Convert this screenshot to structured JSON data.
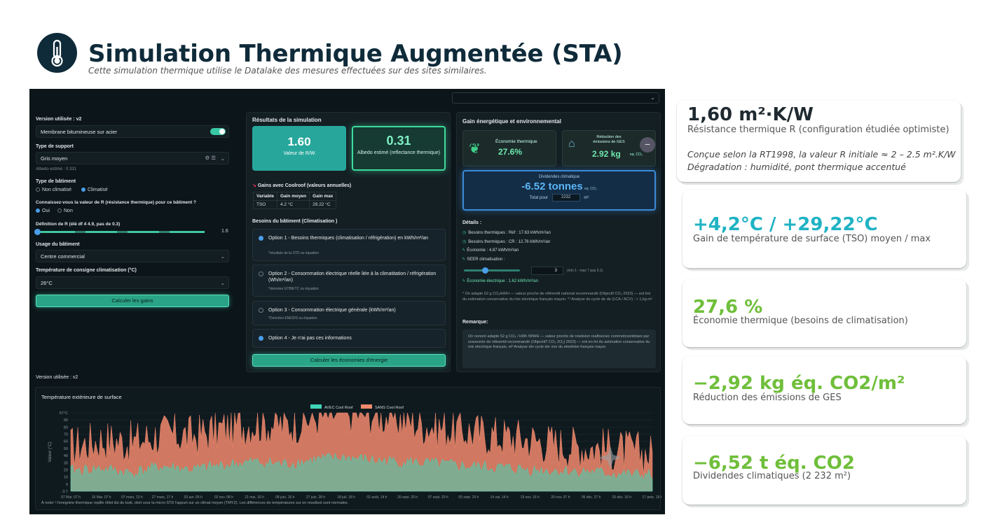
{
  "header": {
    "title": "Simulation Thermique Augmentée (STA)",
    "subtitle": "Cette simulation thermique utilise le Datalake des mesures effectuées sur des sites similaires.",
    "logo_icon": "thermometer-icon"
  },
  "app": {
    "left": {
      "version": "Version utilisée : v2",
      "membrane": "Membrane bitumineuse sur acier",
      "support_label": "Type de support",
      "support_value": "Gris moyen",
      "albedo_note": "Albedo estimé : 0.331",
      "batiment_label": "Type de bâtiment",
      "batiment_opt1": "Non climatisé",
      "batiment_opt2": "Climatisé",
      "r_question": "Connaissez-vous la valeur de R (résistance thermique) pour ce bâtiment ?",
      "r_yes": "Oui",
      "r_no": "Non",
      "r_def": "Définition de R (élé df 4 4.9, pas de 0.3)",
      "r_value": "1.6",
      "usage_label": "Usage du bâtiment",
      "usage_value": "Centre commercial",
      "temp_label": "Température de consigne climatisation (°C)",
      "temp_value": "26°C",
      "calc_button": "Calculer les gains"
    },
    "mid": {
      "title": "Résultats de la simulation",
      "r_value": "1.60",
      "r_caption": "Valeur de R/W",
      "albedo_value": "0.31",
      "albedo_caption": "Albedo estimé (reflectance thermique)",
      "gains_title": "Gains avec Coolroof (valeurs annuelles)",
      "table_headers": [
        "Variable",
        "Gain moyen",
        "Gain max"
      ],
      "table_row": [
        "TSO",
        "4.2 °C",
        "29.22 °C"
      ],
      "besoins_title": "Besoins du bâtiment (Climatisation )",
      "options": [
        {
          "label": "Option 1 - Besoins thermiques (climatisation / réfrigération) en kWh/m²/an",
          "note": "*résultats de la STD ou équation"
        },
        {
          "label": "Option 2 - Consommation électrique réelle liée à la climatitation / réfrigération (Wh/m²/an)",
          "note": "*données GTB/ETC ou équation"
        },
        {
          "label": "Option 3 - Consommation électrique générale (kWh/m²/an)",
          "note": "*Données ENEDIS ou équation"
        },
        {
          "label": "Option 4 - Je n'ai pas ces informations",
          "note": ""
        }
      ],
      "calc_button": "Calculer les économies d'énergie"
    },
    "right": {
      "title": "Gain énergétique et environnemental",
      "eco_label": "Économie thermique",
      "eco_value": "27.6%",
      "ges_label": "Réduction des émissions de GES",
      "ges_value": "2.92 kg",
      "ges_unit": "eq. CO₂",
      "div_label": "Dividendes climatique",
      "div_value": "-6.52 tonnes",
      "div_unit": "eq. CO₂",
      "total_label": "Total pour",
      "total_value": "2232",
      "total_unit": "m²",
      "details_title": "Détails :",
      "d1": "Besoins thermiques : Réf : 17.63 kWh/m²/an",
      "d2": "Besoins thermiques : CR : 12.76 kWh/m²/an",
      "d3": "Économie : 4.87 kWh/m²/an",
      "d4": "SEER climatisation :",
      "seer_value": "3",
      "seer_range": "(min 1 - max 7 pas 0.1)",
      "d5": "Économie électrique : 1.62 kWh/m²/an",
      "note": "* On adapte 52 g CO₂/kWH — valeur proche de référentil national recommandé (Objectif CO₂ 2023) — ent lint du estimation conservative du mix electrique français mayon. *¹ Analyse du cycle de de (LCA / ACV) : < 1,kg m²",
      "remark_title": "Remarque:",
      "remark": "On nonoré adapte 52 g CO₂ / kWh /WWH — valeur proche de nnelision reafloeciec commotcxonbitare par sossesnte de réliventd recommandé (ObjectitT CO₂ 2O₂) 2023) — ent en lnt du astimation conservative du mix electrique français, et³ Analyse din cycle dsr vior du ekedriise français mayor."
    },
    "bottom": {
      "version": "Version utilisée : v2",
      "chart_title": "Température extérieure de surface",
      "footnote": "À noter ! l'enegnine thermique repille ritilst ilst du tosk, olort sour la micro-STD l'appurt sur un climat moyen (TMYZ). Les différences de températures sur en resultsot sont normales."
    }
  },
  "chart_data": {
    "type": "area",
    "title": "Température extérieure de surface",
    "ylabel": "Valeur (°C)",
    "ylim": [
      -3.7,
      67
    ],
    "yticks": [
      "67°C",
      "90",
      "80",
      "70",
      "60",
      "50",
      "40",
      "30",
      "20",
      "10",
      "0",
      "-3.7"
    ],
    "x": [
      "07 Mar. 07 h",
      "16 Mar. 07 h",
      "07 mars, 13 h",
      "27 mars, 17 h",
      "03 avr. 05 h",
      "02 nov. 08 h",
      "21 mai, 16 h",
      "08 juin, 16 h",
      "27 juin, 28 h",
      "18 juil. 18 h",
      "02 août, 14 h",
      "20 sept. 20 h",
      "07 sept. 20 h",
      "05 sept. 15 h",
      "14 vat. 14 h",
      "19 nov. 16 h",
      "20 nov. 07 h",
      "06 déc. 27 h",
      "26 déc. 16 h",
      "17 pets. 19 h"
    ],
    "series": [
      {
        "name": "AVEC Cool Roof",
        "color": "#3fd6b8",
        "values": [
          12,
          14,
          10,
          16,
          13,
          17,
          20,
          18,
          22,
          24,
          21,
          20,
          18,
          16,
          15,
          13,
          12,
          11,
          9,
          8
        ]
      },
      {
        "name": "SANS Cool Roof",
        "color": "#f28a6d",
        "values": [
          28,
          35,
          32,
          40,
          38,
          45,
          50,
          48,
          55,
          60,
          58,
          52,
          46,
          42,
          38,
          35,
          30,
          28,
          25,
          22
        ]
      }
    ],
    "legend": "top-center",
    "grid": true
  },
  "cards": [
    {
      "value": "1,60 m²·K/W",
      "desc": "Résistance thermique R (configuration étudiée optimiste)",
      "extra1": "Conçue selon la RT1998, la valeur R initiale ≈ 2 – 2.5 m².K/W",
      "extra2": "Dégradation : humidité, pont thermique accentué",
      "color": "#1f2a30"
    },
    {
      "value": "+4,2°C / +29,22°C",
      "desc": "Gain de température de surface (TSO) moyen / max",
      "color": "#1fb3c4"
    },
    {
      "value": "27,6 %",
      "desc": "Économie thermique (besoins de climatisation)",
      "color": "#6fbf3a"
    },
    {
      "value": "−2,92 kg éq. CO2/m²",
      "desc": "Réduction des émissions de GES",
      "color": "#6fbf3a"
    },
    {
      "value": "−6,52 t éq. CO2",
      "desc": "Dividendes climatiques (2 232 m²)",
      "color": "#6fbf3a"
    }
  ]
}
